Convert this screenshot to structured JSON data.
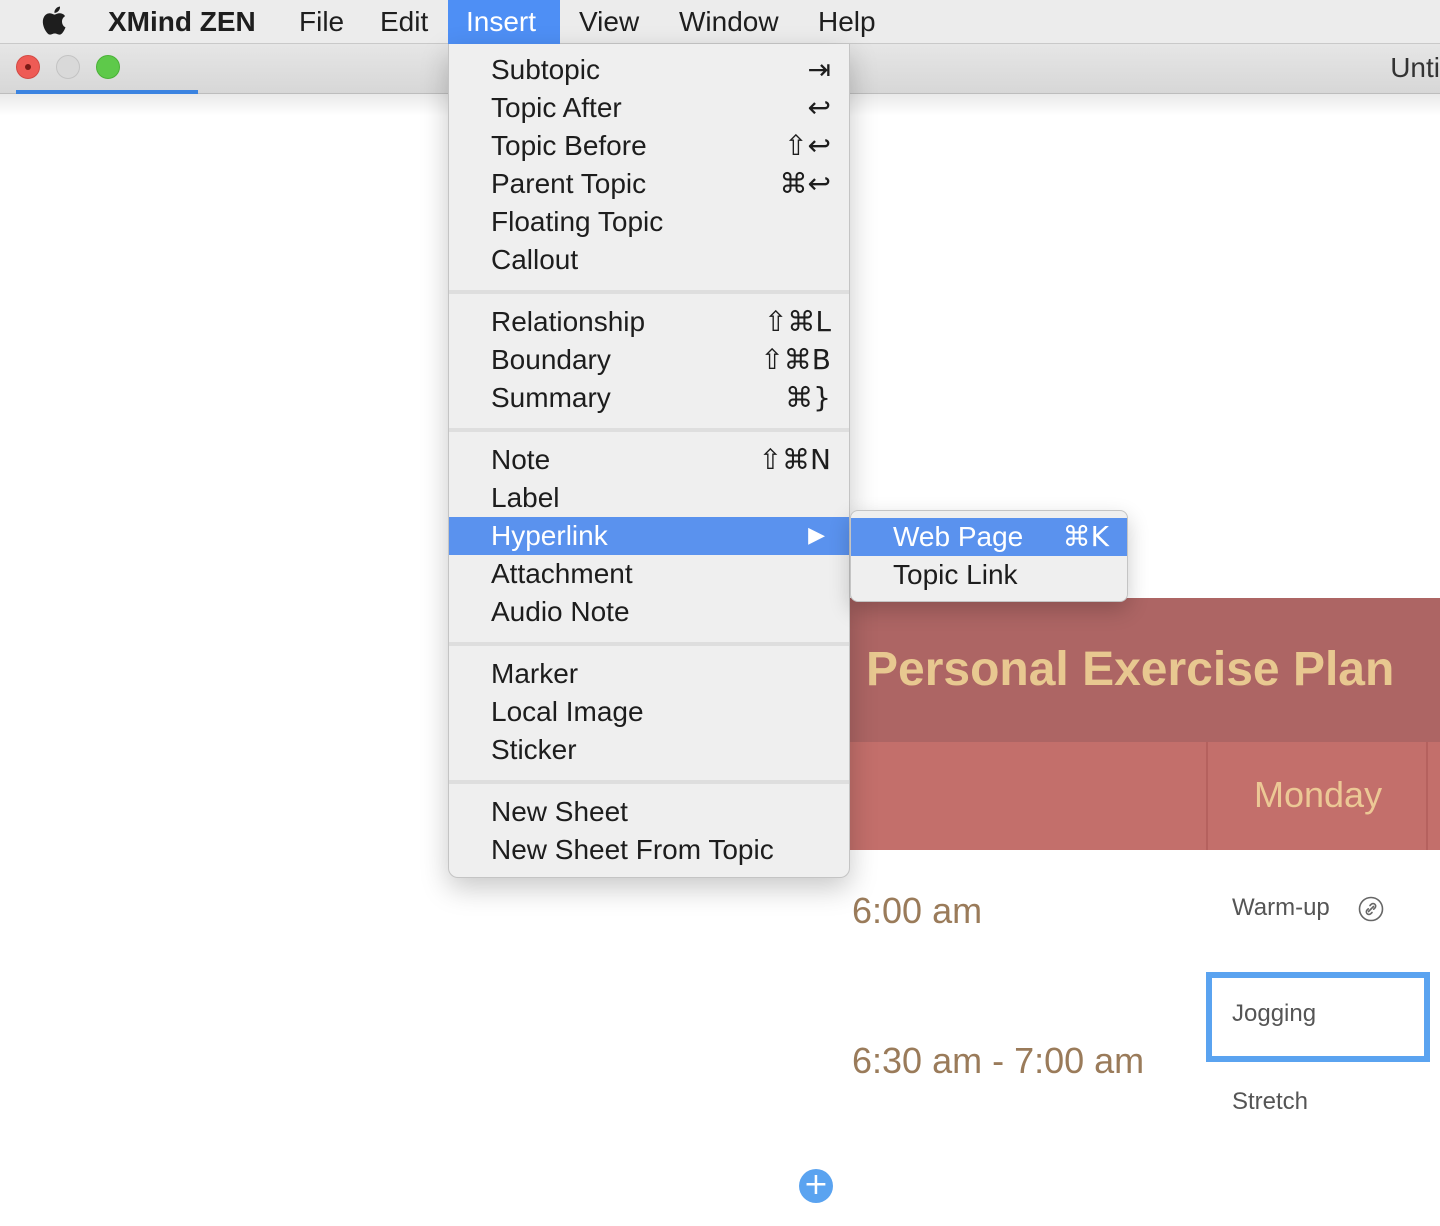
{
  "menubar": {
    "app_name": "XMind ZEN",
    "menus": [
      "File",
      "Edit",
      "Insert",
      "View",
      "Window",
      "Help"
    ],
    "active_menu": "Insert"
  },
  "window": {
    "doc_title": "Unti"
  },
  "insert_menu": {
    "groups": [
      [
        {
          "label": "Subtopic",
          "shortcut": "⇥"
        },
        {
          "label": "Topic After",
          "shortcut": "↩"
        },
        {
          "label": "Topic Before",
          "shortcut": "⇧↩"
        },
        {
          "label": "Parent Topic",
          "shortcut": "⌘↩"
        },
        {
          "label": "Floating Topic",
          "shortcut": ""
        },
        {
          "label": "Callout",
          "shortcut": ""
        }
      ],
      [
        {
          "label": "Relationship",
          "shortcut": "⇧⌘L"
        },
        {
          "label": "Boundary",
          "shortcut": "⇧⌘B"
        },
        {
          "label": "Summary",
          "shortcut": "⌘}"
        }
      ],
      [
        {
          "label": "Note",
          "shortcut": "⇧⌘N"
        },
        {
          "label": "Label",
          "shortcut": ""
        },
        {
          "label": "Hyperlink",
          "shortcut": "▶"
        },
        {
          "label": "Attachment",
          "shortcut": ""
        },
        {
          "label": "Audio Note",
          "shortcut": ""
        }
      ],
      [
        {
          "label": "Marker",
          "shortcut": ""
        },
        {
          "label": "Local Image",
          "shortcut": ""
        },
        {
          "label": "Sticker",
          "shortcut": ""
        }
      ],
      [
        {
          "label": "New Sheet",
          "shortcut": ""
        },
        {
          "label": "New Sheet From Topic",
          "shortcut": ""
        }
      ]
    ],
    "highlighted": "Hyperlink"
  },
  "hyperlink_submenu": {
    "items": [
      {
        "label": "Web Page",
        "shortcut": "⌘K"
      },
      {
        "label": "Topic Link",
        "shortcut": ""
      }
    ],
    "highlighted": "Web Page"
  },
  "canvas": {
    "plan_title": "Personal Exercise Plan",
    "day": "Monday",
    "times": [
      "6:00 am",
      "6:30 am - 7:00 am"
    ],
    "tasks": [
      "Warm-up",
      "Jogging",
      "Stretch"
    ],
    "selected_task": "Jogging"
  },
  "colors": {
    "menu_highlight": "#5a92ee",
    "header_bg": "#ad6564",
    "subrow_bg": "#c36f6b",
    "title_text": "#e8c890",
    "time_text": "#9a7b5a",
    "selection": "#5aa3f0"
  },
  "icons": {
    "apple": "apple-logo-icon",
    "hyperlink": "link-icon",
    "add": "plus-icon",
    "submenu_arrow": "triangle-right-icon"
  }
}
